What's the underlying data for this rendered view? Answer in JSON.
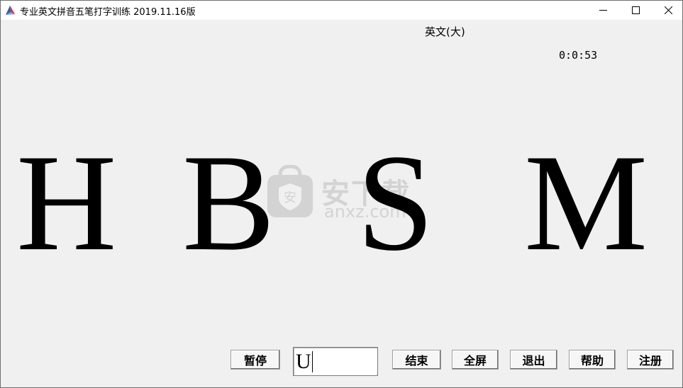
{
  "window": {
    "title": "专业英文拼音五笔打字训练  2019.11.16版"
  },
  "mode": {
    "label": "英文(大)"
  },
  "timer": {
    "value": "0:0:53"
  },
  "letters": [
    "H",
    "B",
    "S",
    "M"
  ],
  "watermark": {
    "brand": "安下载",
    "domain": "anxz.com"
  },
  "input": {
    "value": "U"
  },
  "buttons": {
    "pause": "暂停",
    "end": "结束",
    "fullscreen": "全屏",
    "exit": "退出",
    "help": "帮助",
    "register": "注册"
  },
  "icons": {
    "app": "app-quill-icon",
    "minimize": "minimize-icon",
    "maximize": "maximize-icon",
    "close": "close-icon",
    "watermark": "shield-bag-icon"
  },
  "colors": {
    "background": "#f0f0f0",
    "titlebar": "#ffffff",
    "text": "#000000"
  }
}
